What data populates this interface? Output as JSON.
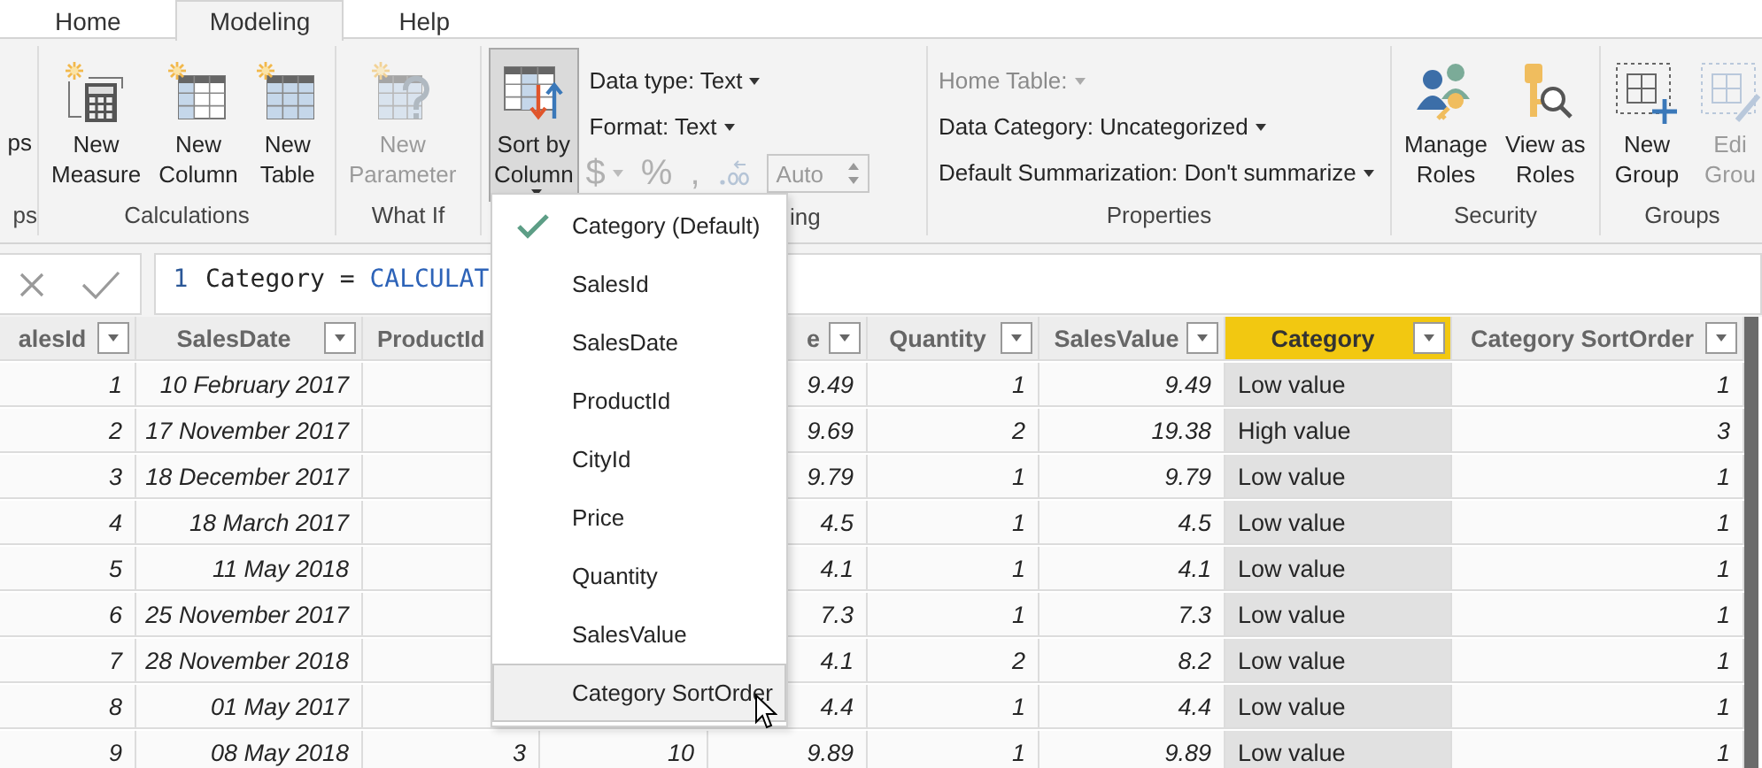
{
  "tabs": [
    {
      "label": "Home",
      "selected": false
    },
    {
      "label": "Modeling",
      "selected": true
    },
    {
      "label": "Help",
      "selected": false
    }
  ],
  "ribbon": {
    "groups": [
      {
        "label": "ps",
        "items": [
          {
            "kind": "large",
            "lines": [
              "ps"
            ],
            "disabled": false,
            "pressed": false,
            "dropdown": false
          }
        ]
      },
      {
        "label": "Calculations",
        "items": [
          {
            "kind": "large",
            "lines": [
              "New",
              "Measure"
            ],
            "disabled": false,
            "pressed": false,
            "dropdown": false
          },
          {
            "kind": "large",
            "lines": [
              "New",
              "Column"
            ],
            "disabled": false,
            "pressed": false,
            "dropdown": false
          },
          {
            "kind": "large",
            "lines": [
              "New",
              "Table"
            ],
            "disabled": false,
            "pressed": false,
            "dropdown": false
          }
        ]
      },
      {
        "label": "What If",
        "items": [
          {
            "kind": "large",
            "lines": [
              "New",
              "Parameter"
            ],
            "disabled": true,
            "pressed": false,
            "dropdown": false
          }
        ]
      },
      {
        "label": "ing",
        "items": [
          {
            "kind": "large",
            "lines": [
              "Sort by",
              "Column"
            ],
            "disabled": false,
            "pressed": true,
            "dropdown": true
          },
          {
            "kind": "stack",
            "rows": [
              {
                "kind": "dropdown",
                "label": "Data type: Text",
                "disabled": false
              },
              {
                "kind": "dropdown",
                "label": "Format: Text",
                "disabled": false
              },
              {
                "kind": "format-row",
                "currency": "$",
                "percent": "%",
                "comma": ",",
                "field_value": "Auto",
                "disabled": true
              }
            ]
          }
        ]
      },
      {
        "label": "Properties",
        "items": [
          {
            "kind": "stack",
            "rows": [
              {
                "kind": "dropdown",
                "label": "Home Table:",
                "disabled": true
              },
              {
                "kind": "dropdown",
                "label": "Data Category: Uncategorized",
                "disabled": false
              },
              {
                "kind": "dropdown",
                "label": "Default Summarization: Don't summarize",
                "disabled": false
              }
            ]
          }
        ]
      },
      {
        "label": "Security",
        "items": [
          {
            "kind": "large",
            "lines": [
              "Manage",
              "Roles"
            ],
            "disabled": false,
            "pressed": false,
            "dropdown": false
          },
          {
            "kind": "large",
            "lines": [
              "View as",
              "Roles"
            ],
            "disabled": false,
            "pressed": false,
            "dropdown": false
          }
        ]
      },
      {
        "label": "Groups",
        "items": [
          {
            "kind": "large",
            "lines": [
              "New",
              "Group"
            ],
            "disabled": false,
            "pressed": false,
            "dropdown": false
          },
          {
            "kind": "large",
            "lines": [
              "Edi",
              "Grou"
            ],
            "disabled": true,
            "pressed": false,
            "dropdown": false
          }
        ]
      }
    ]
  },
  "formula": {
    "line_number": "1",
    "parts": [
      {
        "kind": "plain",
        "text": "Category = "
      },
      {
        "kind": "function",
        "text": "CALCULAT"
      }
    ]
  },
  "table": {
    "columns": [
      {
        "label": "alesId",
        "filter": true,
        "selected": false
      },
      {
        "label": "SalesDate",
        "filter": true,
        "selected": false
      },
      {
        "label": "ProductId",
        "selected": false
      },
      {
        "selected": false
      },
      {
        "label": "e",
        "filter": true,
        "selected": false
      },
      {
        "label": "Quantity",
        "filter": true,
        "selected": false
      },
      {
        "label": "SalesValue",
        "filter": true,
        "selected": false
      },
      {
        "label": "Category",
        "filter": true,
        "selected": true
      },
      {
        "label": "Category SortOrder",
        "filter": true,
        "selected": false
      }
    ],
    "rows": [
      [
        "1",
        "10 February 2017",
        null,
        null,
        "9.49",
        "1",
        "9.49",
        "Low value",
        "1"
      ],
      [
        "2",
        "17 November 2017",
        null,
        null,
        "9.69",
        "2",
        "19.38",
        "High value",
        "3"
      ],
      [
        "3",
        "18 December 2017",
        null,
        null,
        "9.79",
        "1",
        "9.79",
        "Low value",
        "1"
      ],
      [
        "4",
        "18 March 2017",
        null,
        null,
        "4.5",
        "1",
        "4.5",
        "Low value",
        "1"
      ],
      [
        "5",
        "11 May 2018",
        null,
        null,
        "4.1",
        "1",
        "4.1",
        "Low value",
        "1"
      ],
      [
        "6",
        "25 November 2017",
        null,
        null,
        "7.3",
        "1",
        "7.3",
        "Low value",
        "1"
      ],
      [
        "7",
        "28 November 2018",
        null,
        null,
        "4.1",
        "2",
        "8.2",
        "Low value",
        "1"
      ],
      [
        "8",
        "01 May 2017",
        null,
        null,
        "4.4",
        "1",
        "4.4",
        "Low value",
        "1"
      ],
      [
        "9",
        "08 May 2018",
        "3",
        "10",
        "9.89",
        "1",
        "9.89",
        "Low value",
        "1"
      ]
    ]
  },
  "sort_menu": {
    "items": [
      {
        "label": "Category (Default)",
        "checked": true,
        "hovered": false
      },
      {
        "label": "SalesId",
        "checked": false,
        "hovered": false
      },
      {
        "label": "SalesDate",
        "checked": false,
        "hovered": false
      },
      {
        "label": "ProductId",
        "checked": false,
        "hovered": false
      },
      {
        "label": "CityId",
        "checked": false,
        "hovered": false
      },
      {
        "label": "Price",
        "checked": false,
        "hovered": false
      },
      {
        "label": "Quantity",
        "checked": false,
        "hovered": false
      },
      {
        "label": "SalesValue",
        "checked": false,
        "hovered": false
      },
      {
        "label": "Category SortOrder",
        "checked": false,
        "hovered": true
      }
    ]
  }
}
